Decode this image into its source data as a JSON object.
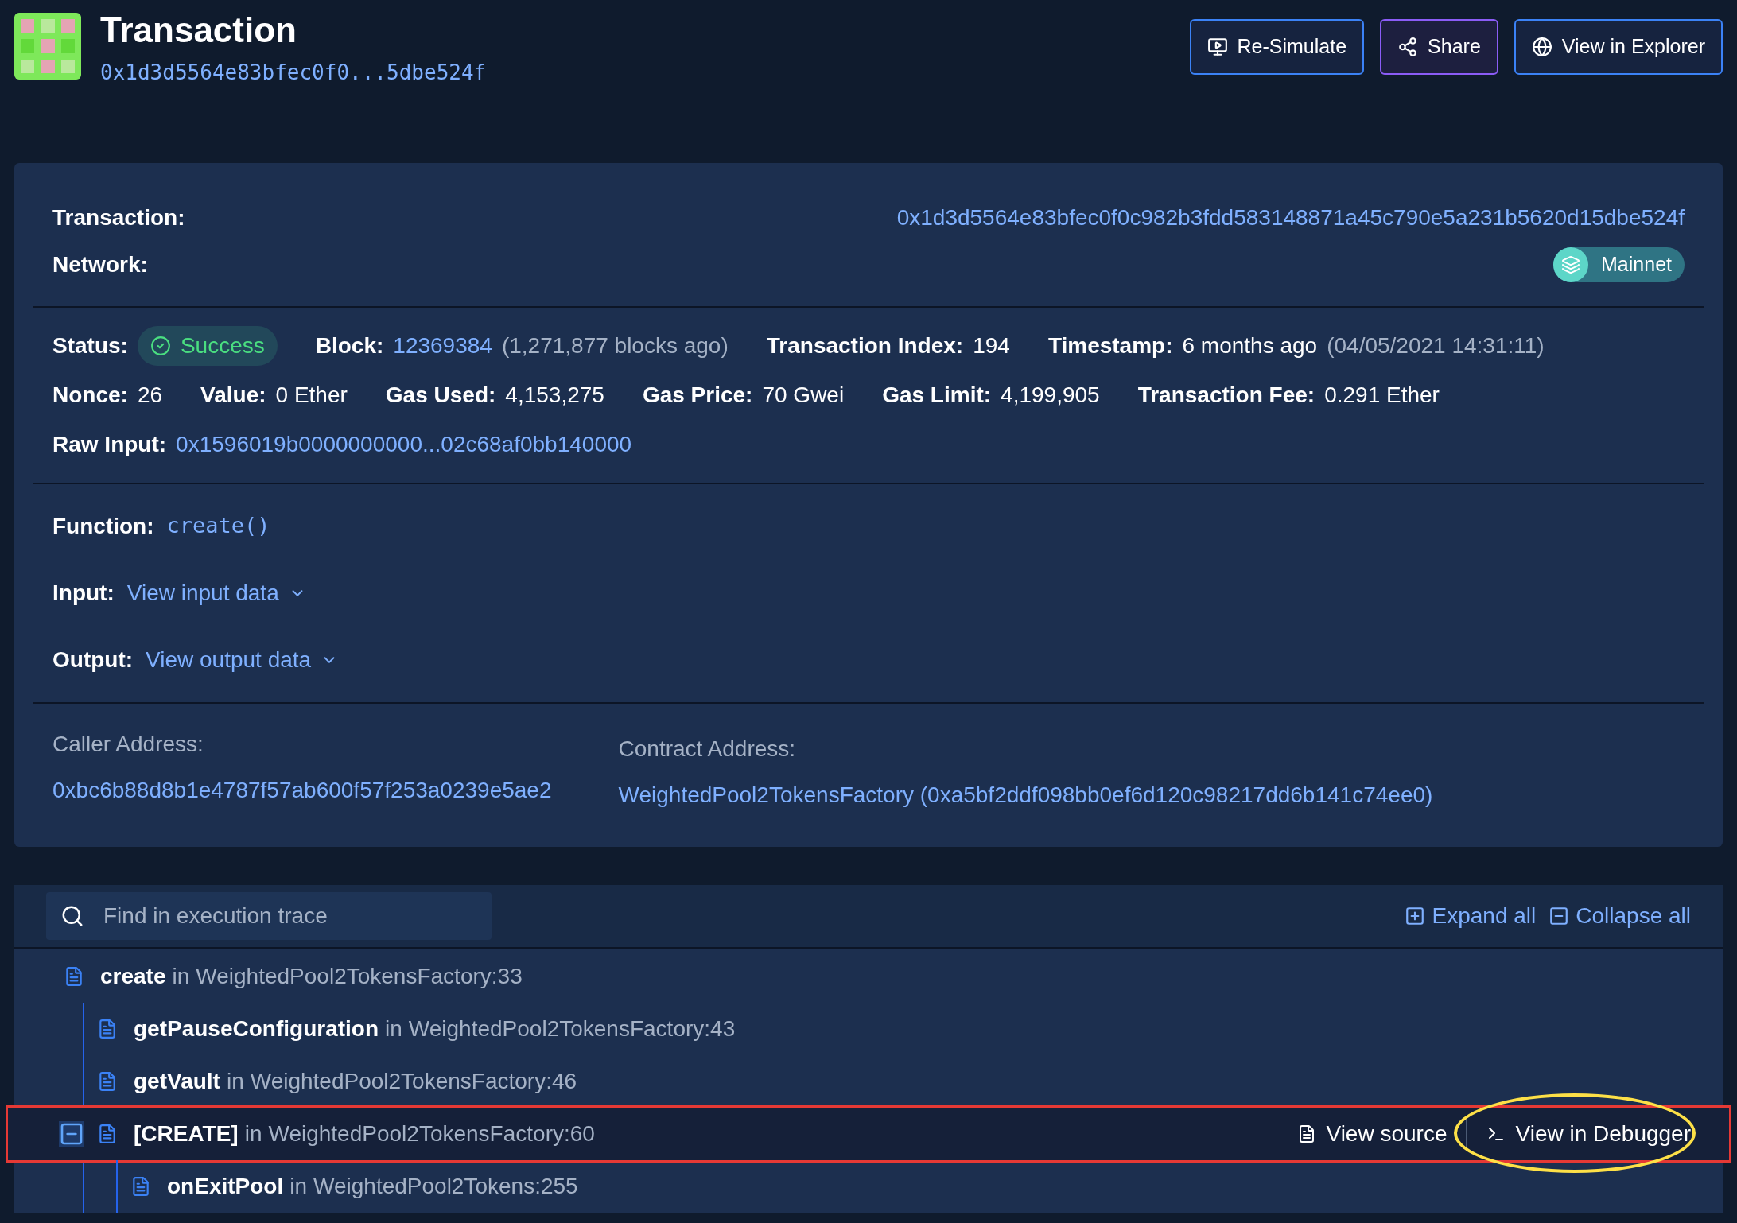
{
  "header": {
    "title": "Transaction",
    "hash": "0x1d3d5564e83bfec0f0...5dbe524f",
    "buttons": [
      {
        "kind": "resimulate",
        "label": "Re-Simulate"
      },
      {
        "kind": "share",
        "label": "Share"
      },
      {
        "kind": "explorer",
        "label": "View in Explorer"
      }
    ]
  },
  "summary": {
    "transaction_label": "Transaction:",
    "transaction_value": "0x1d3d5564e83bfec0f0c982b3fdd583148871a45c790e5a231b5620d15dbe524f",
    "network_label": "Network:",
    "network_value": "Mainnet",
    "lines": [
      {
        "fields": [
          {
            "label": "Status:",
            "kind": "badge",
            "value": "Success"
          },
          {
            "label": "Block:",
            "kind": "link",
            "value": "12369384",
            "note": "(1,271,877 blocks ago)"
          },
          {
            "label": "Transaction Index:",
            "kind": "text",
            "value": "194"
          },
          {
            "label": "Timestamp:",
            "kind": "text",
            "value": "6 months ago",
            "note": "(04/05/2021 14:31:11)"
          }
        ]
      },
      {
        "fields": [
          {
            "label": "Nonce:",
            "kind": "text",
            "value": "26"
          },
          {
            "label": "Value:",
            "kind": "text",
            "value": "0 Ether"
          },
          {
            "label": "Gas Used:",
            "kind": "text",
            "value": "4,153,275"
          },
          {
            "label": "Gas Price:",
            "kind": "text",
            "value": "70 Gwei"
          },
          {
            "label": "Gas Limit:",
            "kind": "text",
            "value": "4,199,905"
          },
          {
            "label": "Transaction Fee:",
            "kind": "text",
            "value": "0.291 Ether"
          }
        ]
      },
      {
        "fields": [
          {
            "label": "Raw Input:",
            "kind": "link",
            "value": "0x1596019b0000000000...02c68af0bb140000"
          }
        ]
      }
    ],
    "function_label": "Function:",
    "function_value": "create()",
    "input_label": "Input:",
    "input_value": "View input data",
    "output_label": "Output:",
    "output_value": "View output data",
    "caller_label": "Caller Address:",
    "caller_value": "0xbc6b88d8b1e4787f57ab600f57f253a0239e5ae2",
    "contract_label": "Contract Address:",
    "contract_value": "WeightedPool2TokensFactory (0xa5bf2ddf098bb0ef6d120c98217dd6b141c74ee0)"
  },
  "trace": {
    "search": {
      "placeholder": "Find in execution trace"
    },
    "expand_all": "Expand all",
    "collapse_all": "Collapse all",
    "items": [
      {
        "name": "create",
        "in": "in",
        "location": "WeightedPool2TokensFactory:33",
        "children": [
          {
            "name": "getPauseConfiguration",
            "in": "in",
            "location": "WeightedPool2TokensFactory:43"
          },
          {
            "name": "getVault",
            "in": "in",
            "location": "WeightedPool2TokensFactory:46"
          },
          {
            "name": "[CREATE]",
            "in": "in",
            "location": "WeightedPool2TokensFactory:60",
            "expanded": true,
            "highlighted": true,
            "view_source": "View source",
            "view_debugger": "View in Debugger",
            "children": [
              {
                "name": "onExitPool",
                "in": "in",
                "location": "WeightedPool2Tokens:255"
              }
            ]
          }
        ]
      }
    ]
  }
}
